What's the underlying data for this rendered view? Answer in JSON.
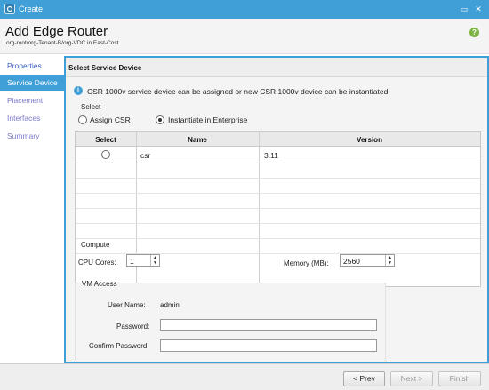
{
  "window": {
    "title": "Create",
    "minimize_glyph": "▭",
    "close_glyph": "✕"
  },
  "header": {
    "title": "Add Edge Router",
    "path": "org-root/org-Tenant-B/org-VDC in East-Cost",
    "help_glyph": "?"
  },
  "sidebar": {
    "items": [
      {
        "label": "Properties",
        "state": "done"
      },
      {
        "label": "Service Device",
        "state": "active"
      },
      {
        "label": "Placement",
        "state": "pending"
      },
      {
        "label": "Interfaces",
        "state": "pending"
      },
      {
        "label": "Summary",
        "state": "pending"
      }
    ]
  },
  "section": {
    "title": "Select Service Device",
    "info_glyph": "i",
    "info_text": "CSR 1000v service device can be assigned or new CSR 1000v device can be instantiated",
    "select_label": "Select",
    "options": [
      {
        "label": "Assign CSR",
        "checked": false
      },
      {
        "label": "Instantiate in Enterprise",
        "checked": true
      }
    ]
  },
  "table": {
    "columns": [
      "Select",
      "Name",
      "Version"
    ],
    "rows": [
      {
        "selected": false,
        "name": "csr",
        "version": "3.11"
      }
    ]
  },
  "compute": {
    "legend": "Compute",
    "cpu_label": "CPU Cores:",
    "cpu_value": "1",
    "memory_label": "Memory (MB):",
    "memory_value": "2560",
    "up_glyph": "▲",
    "down_glyph": "▼"
  },
  "vm_access": {
    "legend": "VM Access",
    "username_label": "User Name:",
    "username_value": "admin",
    "password_label": "Password:",
    "password_value": "",
    "confirm_label": "Confirm Password:",
    "confirm_value": ""
  },
  "footer": {
    "prev_label": "< Prev",
    "next_label": "Next >",
    "finish_label": "Finish"
  },
  "colors": {
    "accent": "#3f9fd6",
    "help": "#7cb342",
    "link": "#3a5ec4"
  }
}
